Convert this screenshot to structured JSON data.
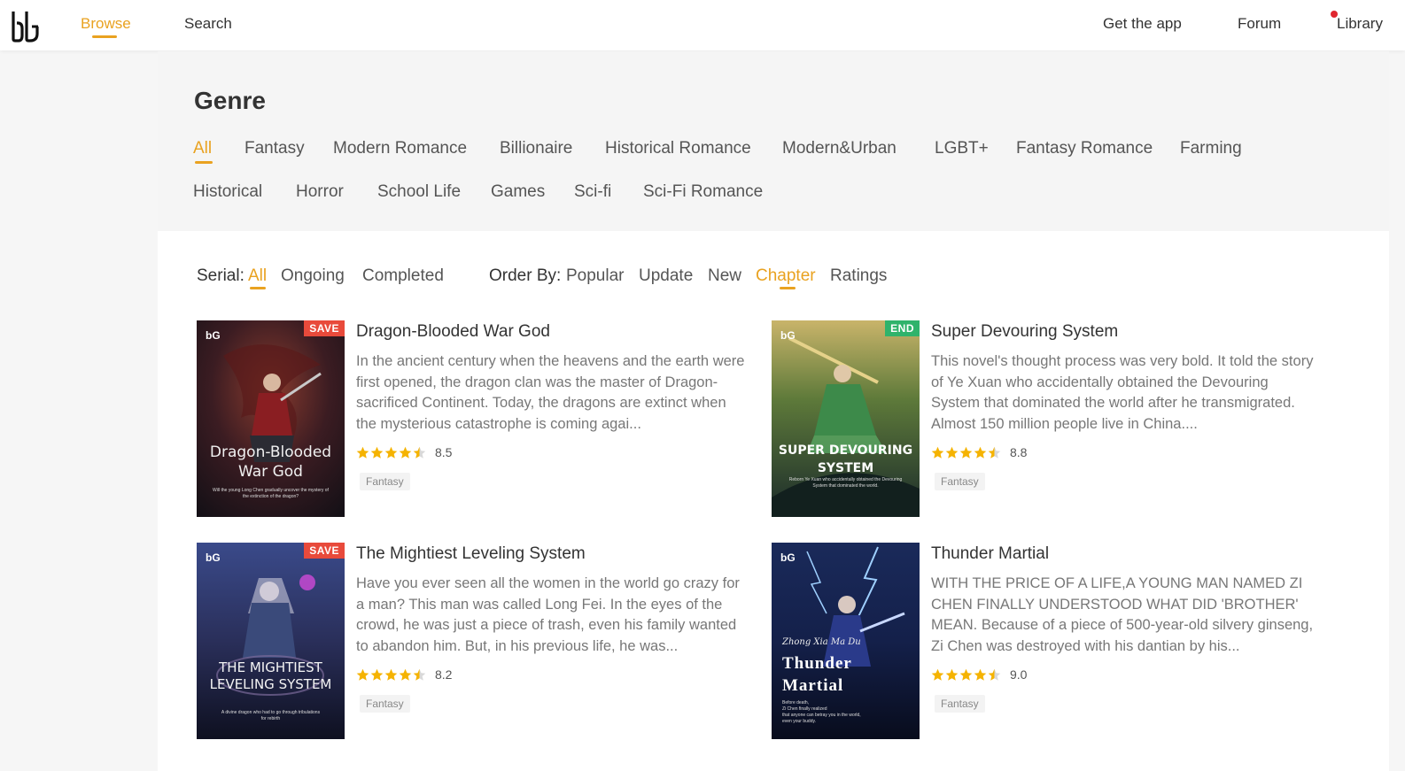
{
  "nav": {
    "browse": "Browse",
    "search": "Search",
    "get_app": "Get the app",
    "forum": "Forum",
    "library": "Library"
  },
  "genre": {
    "title": "Genre",
    "items": [
      "All",
      "Fantasy",
      "Modern Romance",
      "Billionaire",
      "Historical Romance",
      "Modern&Urban",
      "LGBT+",
      "Fantasy Romance",
      "Farming",
      "Historical",
      "Horror",
      "School Life",
      "Games",
      "Sci-fi",
      "Sci-Fi Romance"
    ],
    "selected": "All"
  },
  "filters": {
    "serial_label": "Serial:",
    "serial": [
      "All",
      "Ongoing",
      "Completed"
    ],
    "serial_selected": "All",
    "order_label": "Order By:",
    "order": [
      "Popular",
      "Update",
      "New",
      "Chapter",
      "Ratings"
    ],
    "order_selected": "Chapter"
  },
  "books": [
    {
      "title": "Dragon-Blooded War God",
      "description": "In the ancient century when the heavens and the earth were first opened, the dragon clan was the master of Dragon-sacrificed Continent. Today, the dragons are extinct when the mysterious catastrophe is coming agai...",
      "rating": 8.5,
      "stars": 4.5,
      "genre": "Fantasy",
      "badge": "SAVE",
      "cover_logo": "bG",
      "cover_title": [
        "Dragon-Blooded",
        "War God"
      ],
      "cover_tagline": [
        "Will the young Long Chen gradually uncover the mystery of",
        "the extinction of the dragon?"
      ]
    },
    {
      "title": "Super Devouring System",
      "description": "This novel's thought process was very bold. It told the story of Ye Xuan who accidentally obtained the Devouring System that dominated the world after he transmigrated. Almost 150 million people live in China....",
      "rating": 8.8,
      "stars": 4.5,
      "genre": "Fantasy",
      "badge": "END",
      "cover_logo": "bG",
      "cover_title": [
        "SUPER DEVOURING",
        "SYSTEM"
      ],
      "cover_tagline": [
        "Reborn Ye Xuan who accidentally obtained the Devouring",
        "System that dominated the world."
      ]
    },
    {
      "title": "The Mightiest Leveling System",
      "description": "Have you ever seen all the women in the world go crazy for a man? This man was called Long Fei. In the eyes of the crowd, he was just a piece of trash, even his family wanted to abandon him. But, in his previous life, he was...",
      "rating": 8.2,
      "stars": 4.5,
      "genre": "Fantasy",
      "badge": "SAVE",
      "cover_logo": "bG",
      "cover_title": [
        "THE MIGHTIEST",
        "LEVELING SYSTEM"
      ],
      "cover_tagline": [
        "A divine dragon who had to go through tribulations",
        "for rebirth"
      ]
    },
    {
      "title": "Thunder Martial",
      "description": "WITH THE PRICE OF A LIFE,A YOUNG MAN NAMED ZI CHEN FINALLY UNDERSTOOD WHAT DID 'BROTHER' MEAN. Because of a piece of 500-year-old silvery ginseng, Zi Chen was destroyed with his dantian by his...",
      "rating": 9.0,
      "stars": 4.5,
      "genre": "Fantasy",
      "badge": "",
      "cover_logo": "bG",
      "cover_author": "Zhong Xia Ma Du",
      "cover_title": [
        "Thunder",
        "Martial"
      ],
      "cover_tagline": [
        "Before death,",
        "Zi Chen finally realized",
        "that anyone can betray you in the world,",
        "even your buddy."
      ]
    }
  ],
  "colors": {
    "accent": "#e9a220",
    "save_badge": "#e84a3b",
    "end_badge": "#2fb36b",
    "star": "#f5b301",
    "notification_dot": "#e0262f"
  },
  "icons": {
    "logo": "webnovel-logo",
    "star": "star-icon",
    "half_star": "half-star-icon"
  }
}
